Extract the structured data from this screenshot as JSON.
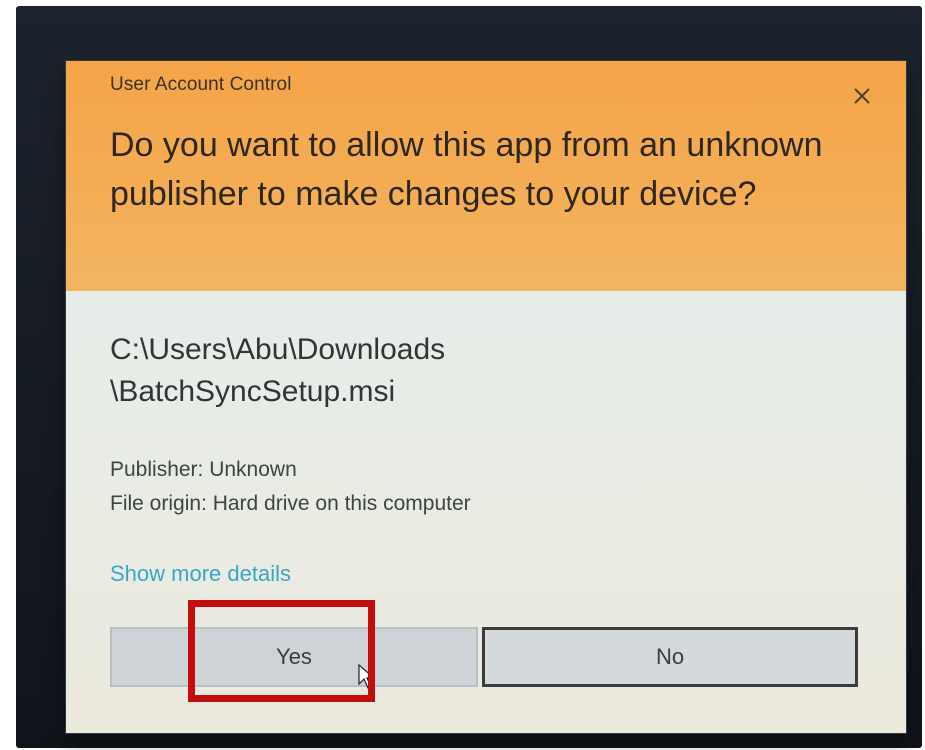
{
  "dialog": {
    "app_title": "User Account Control",
    "question": "Do you want to allow this app from an unknown publisher to make changes to your device?",
    "file_path_line1": "C:\\Users\\Abu\\Downloads",
    "file_path_line2": "\\BatchSyncSetup.msi",
    "publisher": "Publisher: Unknown",
    "file_origin": "File origin: Hard drive on this computer",
    "details_link": "Show more details",
    "yes_label": "Yes",
    "no_label": "No"
  },
  "icons": {
    "close": "close-icon",
    "cursor": "mouse-cursor-icon"
  },
  "colors": {
    "header": "#f4ab52",
    "body": "#e4eae6",
    "link": "#3aa6c4",
    "highlight": "#c40d0d"
  }
}
